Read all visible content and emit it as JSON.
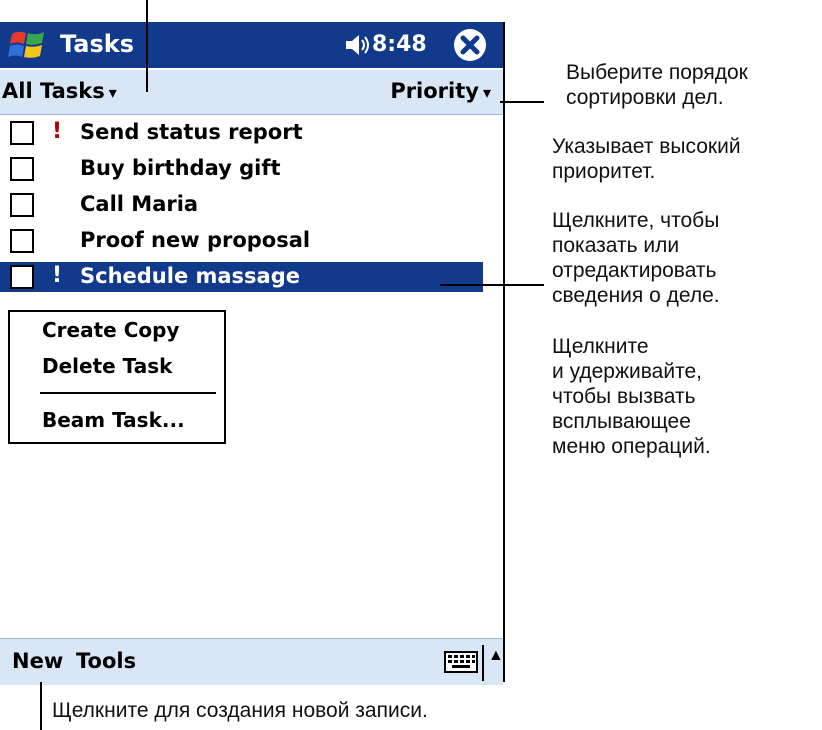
{
  "titlebar": {
    "title": "Tasks",
    "time": "8:48",
    "start_icon": "windows-flag-icon",
    "speaker_icon": "speaker-icon",
    "close_icon": "close-icon",
    "bg_color": "#123a8c"
  },
  "toolbar": {
    "filter_label": "All Tasks",
    "filter_arrow": "▾",
    "sort_label": "Priority",
    "sort_arrow": "▾",
    "bg_color": "#d9e6f5"
  },
  "tasks": [
    {
      "label": "Send status report",
      "priority": "!",
      "selected": false
    },
    {
      "label": "Buy birthday gift",
      "priority": "",
      "selected": false
    },
    {
      "label": "Call Maria",
      "priority": "",
      "selected": false
    },
    {
      "label": "Proof new proposal",
      "priority": "",
      "selected": false
    },
    {
      "label": "Schedule massage",
      "priority": "!",
      "selected": true
    }
  ],
  "context_menu": {
    "items": [
      "Create Copy",
      "Delete Task",
      "Beam Task..."
    ]
  },
  "menubar": {
    "new_label": "New",
    "tools_label": "Tools",
    "sip_arrow": "▲"
  },
  "annotations": {
    "sort_order": [
      "Выберите порядок",
      "сортировки дел."
    ],
    "high_priority": [
      "Указывает высокий",
      "приоритет."
    ],
    "tap_show_edit": [
      "Щелкните, чтобы",
      "показать или",
      "отредактировать",
      "сведения о деле."
    ],
    "tap_hold": [
      "Щелкните",
      "и удерживайте,",
      "чтобы вызвать",
      "всплывающее",
      "меню операций."
    ],
    "new_record": "Щелкните для создания новой записи."
  }
}
